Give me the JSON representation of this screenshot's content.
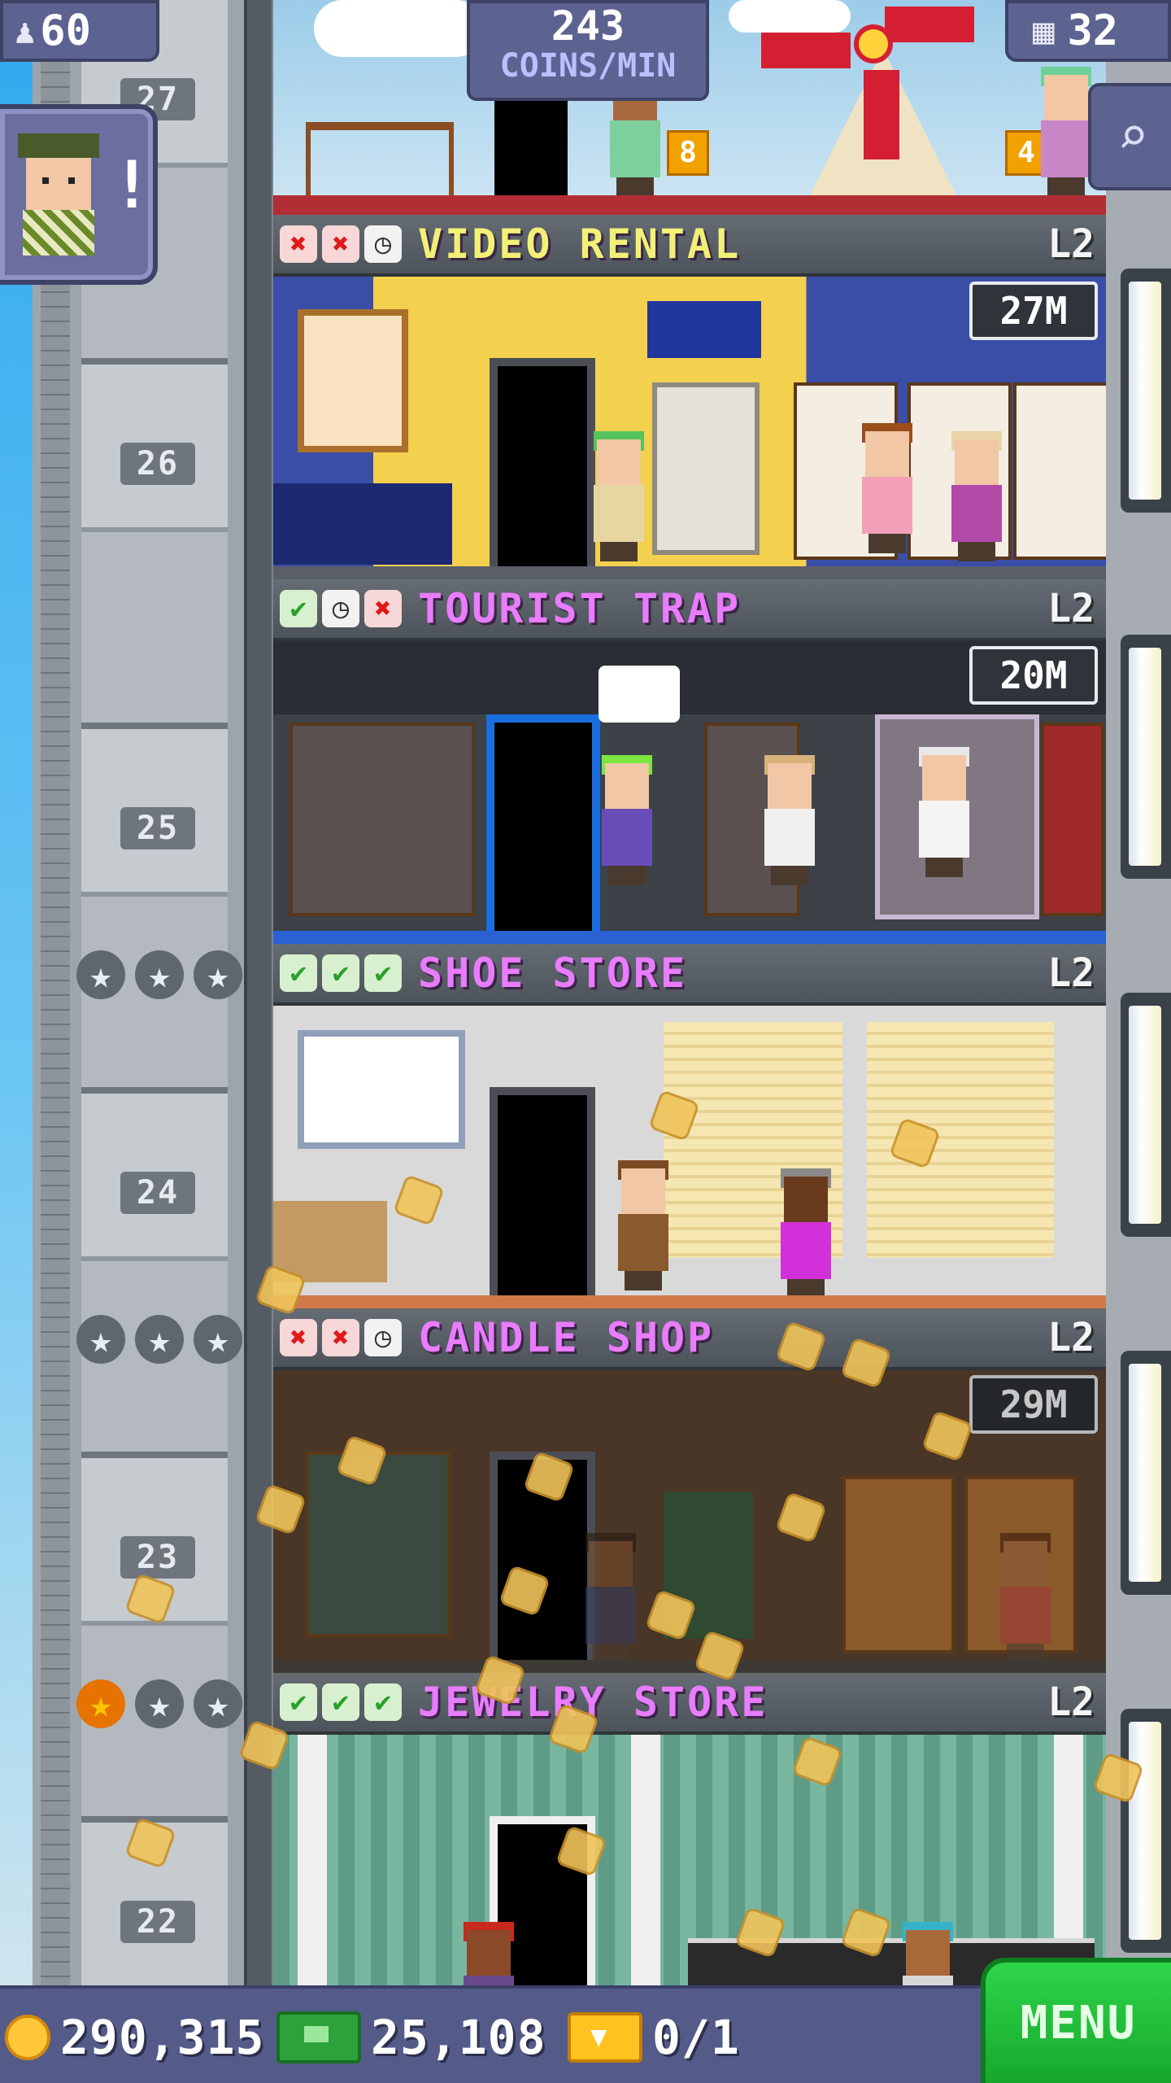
{
  "hud": {
    "population": "60",
    "coins_per_min_value": "243",
    "coins_per_min_label": "COINS/MIN",
    "floor_count": "32"
  },
  "lobby": {
    "sign_left": "8",
    "sign_right": "4"
  },
  "shaft": {
    "floor_numbers": [
      "27",
      "26",
      "25",
      "24",
      "23",
      "22"
    ]
  },
  "floors": [
    {
      "name": "VIDEO RENTAL",
      "level": "L2",
      "stock": "27M",
      "status": [
        "cross",
        "cross",
        "clock"
      ]
    },
    {
      "name": "TOURIST TRAP",
      "level": "L2",
      "stock": "20M",
      "status": [
        "check",
        "clock",
        "cross"
      ]
    },
    {
      "name": "SHOE STORE",
      "level": "L2",
      "stock": "",
      "status": [
        "check",
        "check",
        "check"
      ],
      "stars": 0
    },
    {
      "name": "CANDLE SHOP",
      "level": "L2",
      "stock": "29M",
      "status": [
        "cross",
        "cross",
        "clock"
      ],
      "stars": 0
    },
    {
      "name": "JEWELRY STORE",
      "level": "L2",
      "stock": "",
      "status": [
        "check",
        "check",
        "check"
      ],
      "stars": 1
    }
  ],
  "bottom_bar": {
    "coins": "290,315",
    "bux": "25,108",
    "tickets": "0/1",
    "menu_label": "MENU"
  },
  "icons": {
    "check": "✔",
    "cross": "✖",
    "clock": "◷",
    "star": "★",
    "person": "♟",
    "floors": "▦",
    "search": "⌕"
  },
  "colors": {
    "hud": "#5d6390",
    "floor_name": "#e97cff",
    "menu": "#1fbf38",
    "coin": "#ffc83a"
  }
}
